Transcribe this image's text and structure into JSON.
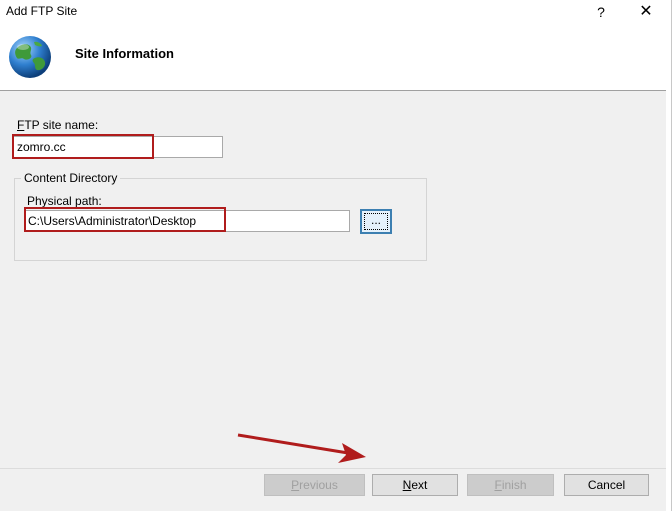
{
  "window": {
    "title": "Add FTP Site",
    "help_glyph": "?",
    "close_glyph": "✕"
  },
  "banner": {
    "title": "Site Information",
    "icon": "globe-icon"
  },
  "form": {
    "site_name_label_accel": "F",
    "site_name_label_rest": "TP site name:",
    "site_name_value": "zomro.cc",
    "content_directory_caption": "Content Directory",
    "physical_path_label": "Physical path:",
    "physical_path_value": "C:\\Users\\Administrator\\Desktop",
    "browse_label": "..."
  },
  "buttons": {
    "previous_accel": "P",
    "previous_rest": "revious",
    "next_accel": "N",
    "next_rest": "ext",
    "finish_accel": "F",
    "finish_rest": "inish",
    "cancel_label": "Cancel"
  },
  "colors": {
    "highlight": "#b01c1c",
    "arrow": "#b01c1c"
  }
}
